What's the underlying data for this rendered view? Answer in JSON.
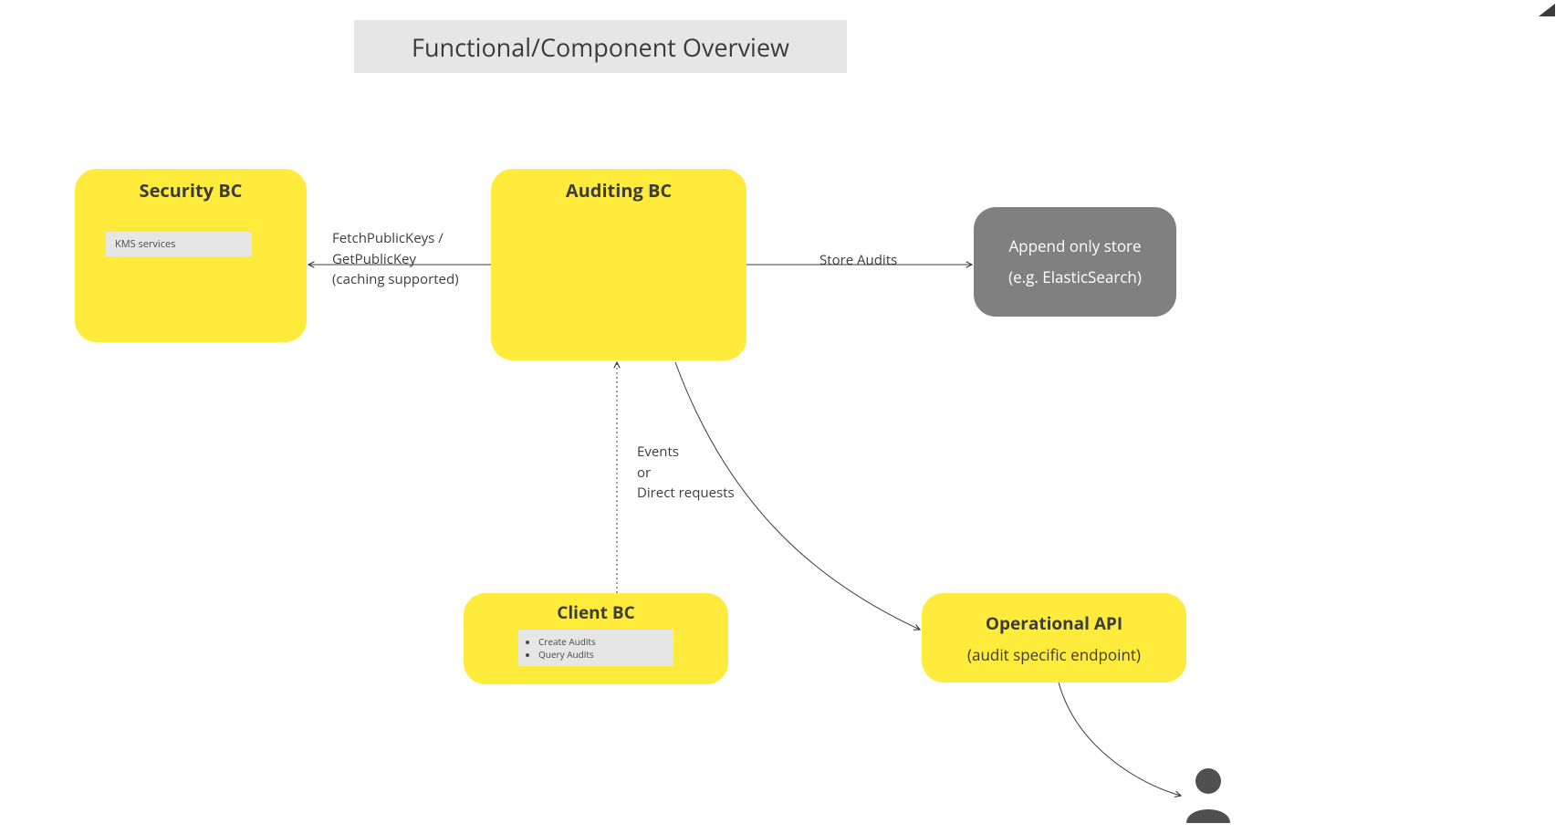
{
  "title": "Functional/Component Overview",
  "nodes": {
    "security": {
      "title": "Security BC",
      "sub": "KMS services"
    },
    "auditing": {
      "title": "Auditing BC"
    },
    "store": {
      "line1": "Append only store",
      "line2": "(e.g. ElasticSearch)"
    },
    "client": {
      "title": "Client BC",
      "items": [
        "Create Audits",
        "Query Audits"
      ]
    },
    "operational": {
      "title": "Operational API",
      "sub": "(audit specific endpoint)"
    }
  },
  "edges": {
    "security_auditing": {
      "line1": "FetchPublicKeys /",
      "line2": "GetPublicKey",
      "line3": "(caching supported)"
    },
    "auditing_store": "Store Audits",
    "client_auditing": {
      "line1": "Events",
      "line2": "or",
      "line3": "Direct requests"
    }
  }
}
